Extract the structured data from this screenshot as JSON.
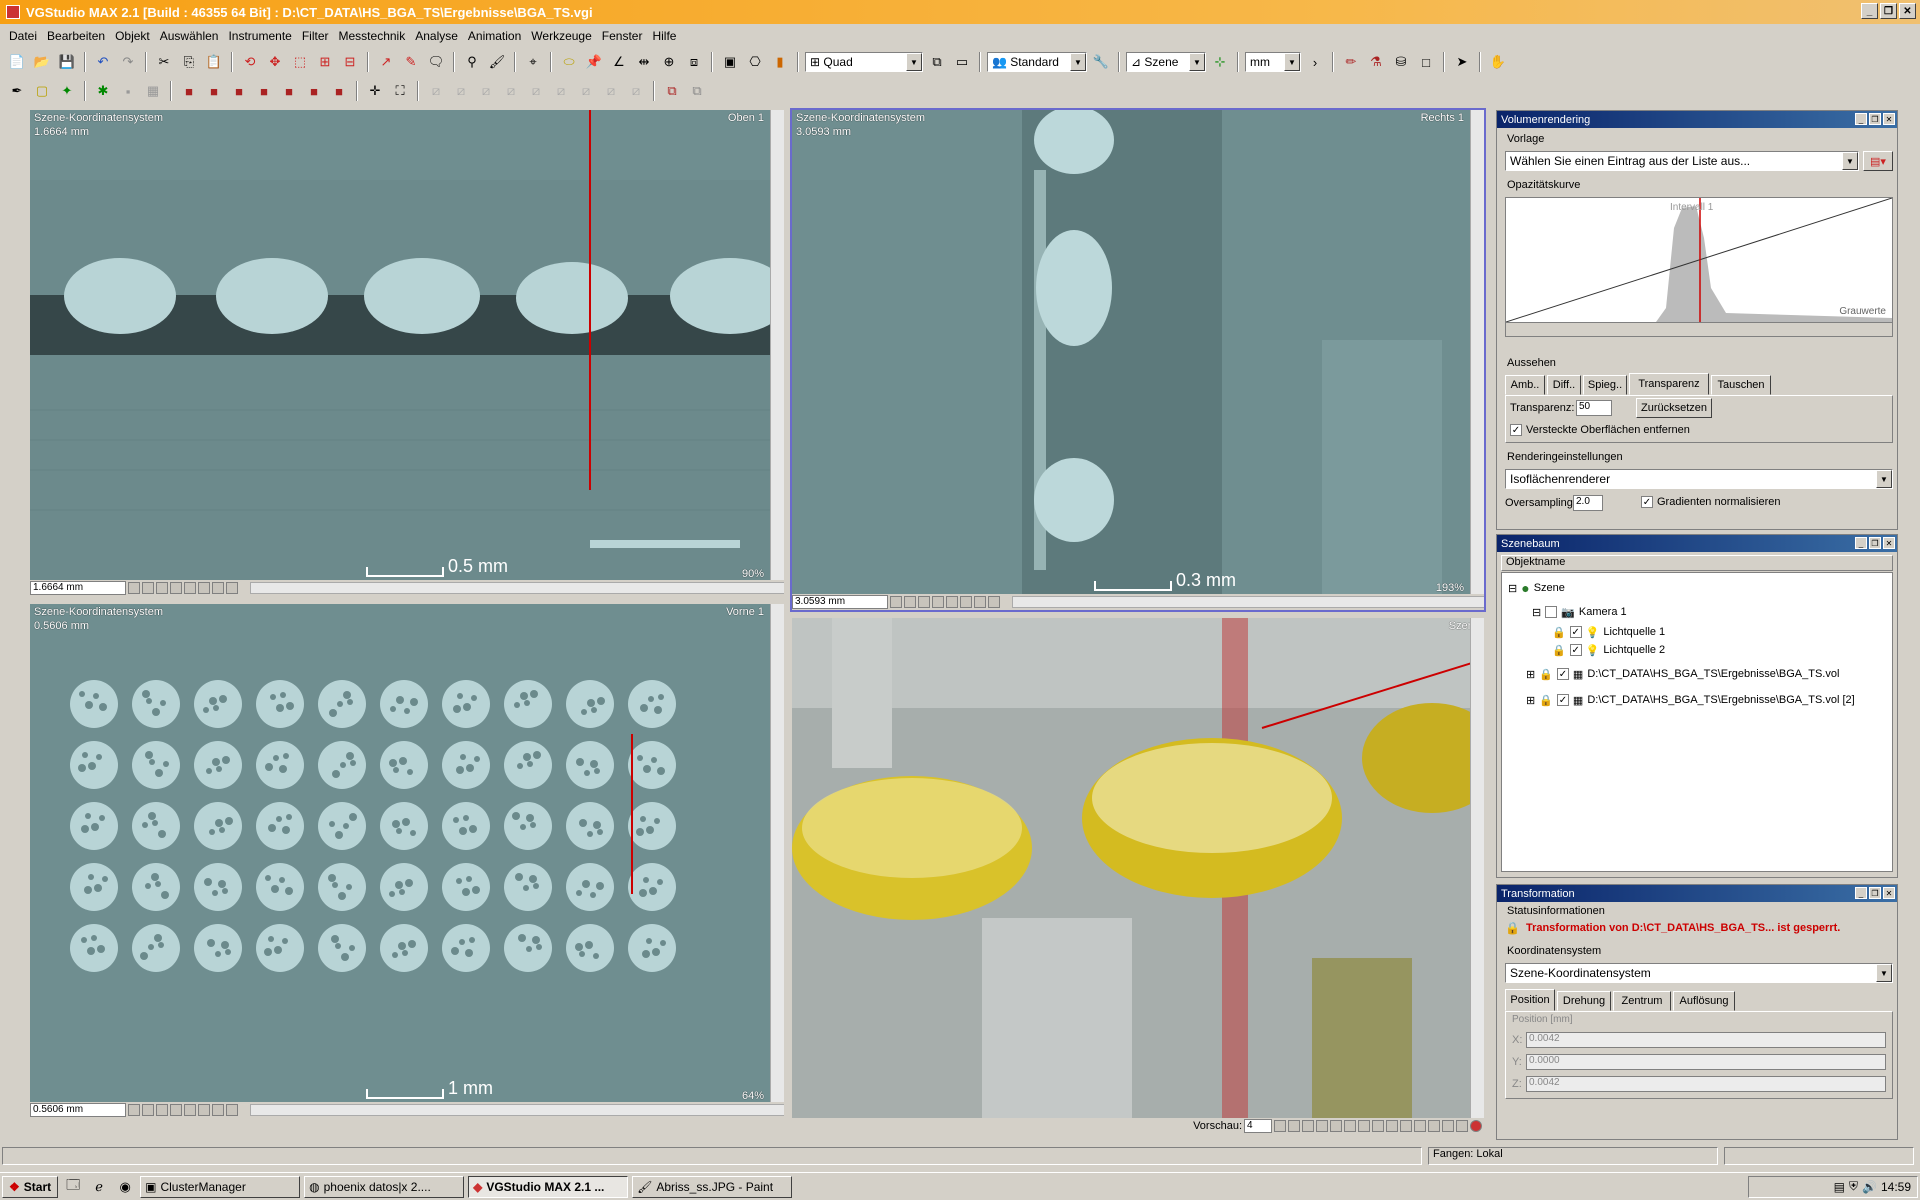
{
  "window": {
    "title": "VGStudio MAX 2.1  [Build : 46355   64 Bit] :  D:\\CT_DATA\\HS_BGA_TS\\Ergebnisse\\BGA_TS.vgi"
  },
  "menu": [
    "Datei",
    "Bearbeiten",
    "Objekt",
    "Auswählen",
    "Instrumente",
    "Filter",
    "Messtechnik",
    "Analyse",
    "Animation",
    "Werkzeuge",
    "Fenster",
    "Hilfe"
  ],
  "toolbar": {
    "layout": "Quad",
    "render_mode": "Standard",
    "coord": "Szene",
    "unit": "mm"
  },
  "views": {
    "top_left": {
      "coord_label": "Szene-Koordinatensystem",
      "size": "1.6664 mm",
      "corner": "Oben 1",
      "scale": "0.5 mm",
      "zoom": "90%",
      "field": "1.6664 mm"
    },
    "top_right": {
      "coord_label": "Szene-Koordinatensystem",
      "size": "3.0593 mm",
      "corner": "Rechts 1",
      "scale": "0.3 mm",
      "zoom": "193%",
      "field": "3.0593 mm"
    },
    "bottom_left": {
      "coord_label": "Szene-Koordinatensystem",
      "size": "0.5606 mm",
      "corner": "Vorne 1",
      "scale": "1 mm",
      "zoom": "64%",
      "field": "0.5606 mm"
    },
    "bottom_right": {
      "corner": "Szene",
      "preview_label": "Vorschau:",
      "preview_value": "4"
    }
  },
  "volume_panel": {
    "title": "Volumenrendering",
    "vorlage_label": "Vorlage",
    "vorlage_value": "Wählen Sie einen Eintrag aus der Liste aus...",
    "opacity_label": "Opazitätskurve",
    "interval_label": "Intervall 1",
    "grey_label": "Grauwerte",
    "appearance_label": "Aussehen",
    "tabs": [
      "Amb..",
      "Diff..",
      "Spieg..",
      "Transparenz",
      "Tauschen"
    ],
    "transparency_label": "Transparenz:",
    "transparency_value": "50",
    "reset_button": "Zurücksetzen",
    "hidden_surfaces": "Versteckte Oberflächen entfernen",
    "render_settings_label": "Renderingeinstellungen",
    "renderer": "Isoflächenrenderer",
    "oversampling_label": "Oversampling:",
    "oversampling_value": "2.0",
    "normalize_gradients": "Gradienten normalisieren"
  },
  "scene_tree": {
    "title": "Szenebaum",
    "column": "Objektname",
    "items": [
      "Szene",
      "Kamera 1",
      "Lichtquelle 1",
      "Lichtquelle 2",
      "D:\\CT_DATA\\HS_BGA_TS\\Ergebnisse\\BGA_TS.vol",
      "D:\\CT_DATA\\HS_BGA_TS\\Ergebnisse\\BGA_TS.vol [2]"
    ]
  },
  "transform_panel": {
    "title": "Transformation",
    "status_label": "Statusinformationen",
    "status_text": "Transformation von D:\\CT_DATA\\HS_BGA_TS... ist gesperrt.",
    "coord_label": "Koordinatensystem",
    "coord_value": "Szene-Koordinatensystem",
    "tabs": [
      "Position",
      "Drehung",
      "Zentrum",
      "Auflösung"
    ],
    "position_label": "Position [mm]",
    "x_label": "X:",
    "x": "0.0042",
    "y_label": "Y:",
    "y": "0.0000",
    "z_label": "Z:",
    "z": "0.0042"
  },
  "statusbar": {
    "snap": "Fangen: Lokal"
  },
  "taskbar": {
    "start": "Start",
    "tasks": [
      "ClusterManager",
      "phoenix datos|x 2....",
      "VGStudio MAX 2.1 ...",
      "Abriss_ss.JPG - Paint"
    ],
    "clock": "14:59"
  },
  "colors": {
    "accent_title": "#f7a014",
    "panel_title": "#0a246a",
    "ct_slice": "#6e8d8f",
    "solder": "#d9c22a",
    "locked_status": "#cc0000"
  }
}
